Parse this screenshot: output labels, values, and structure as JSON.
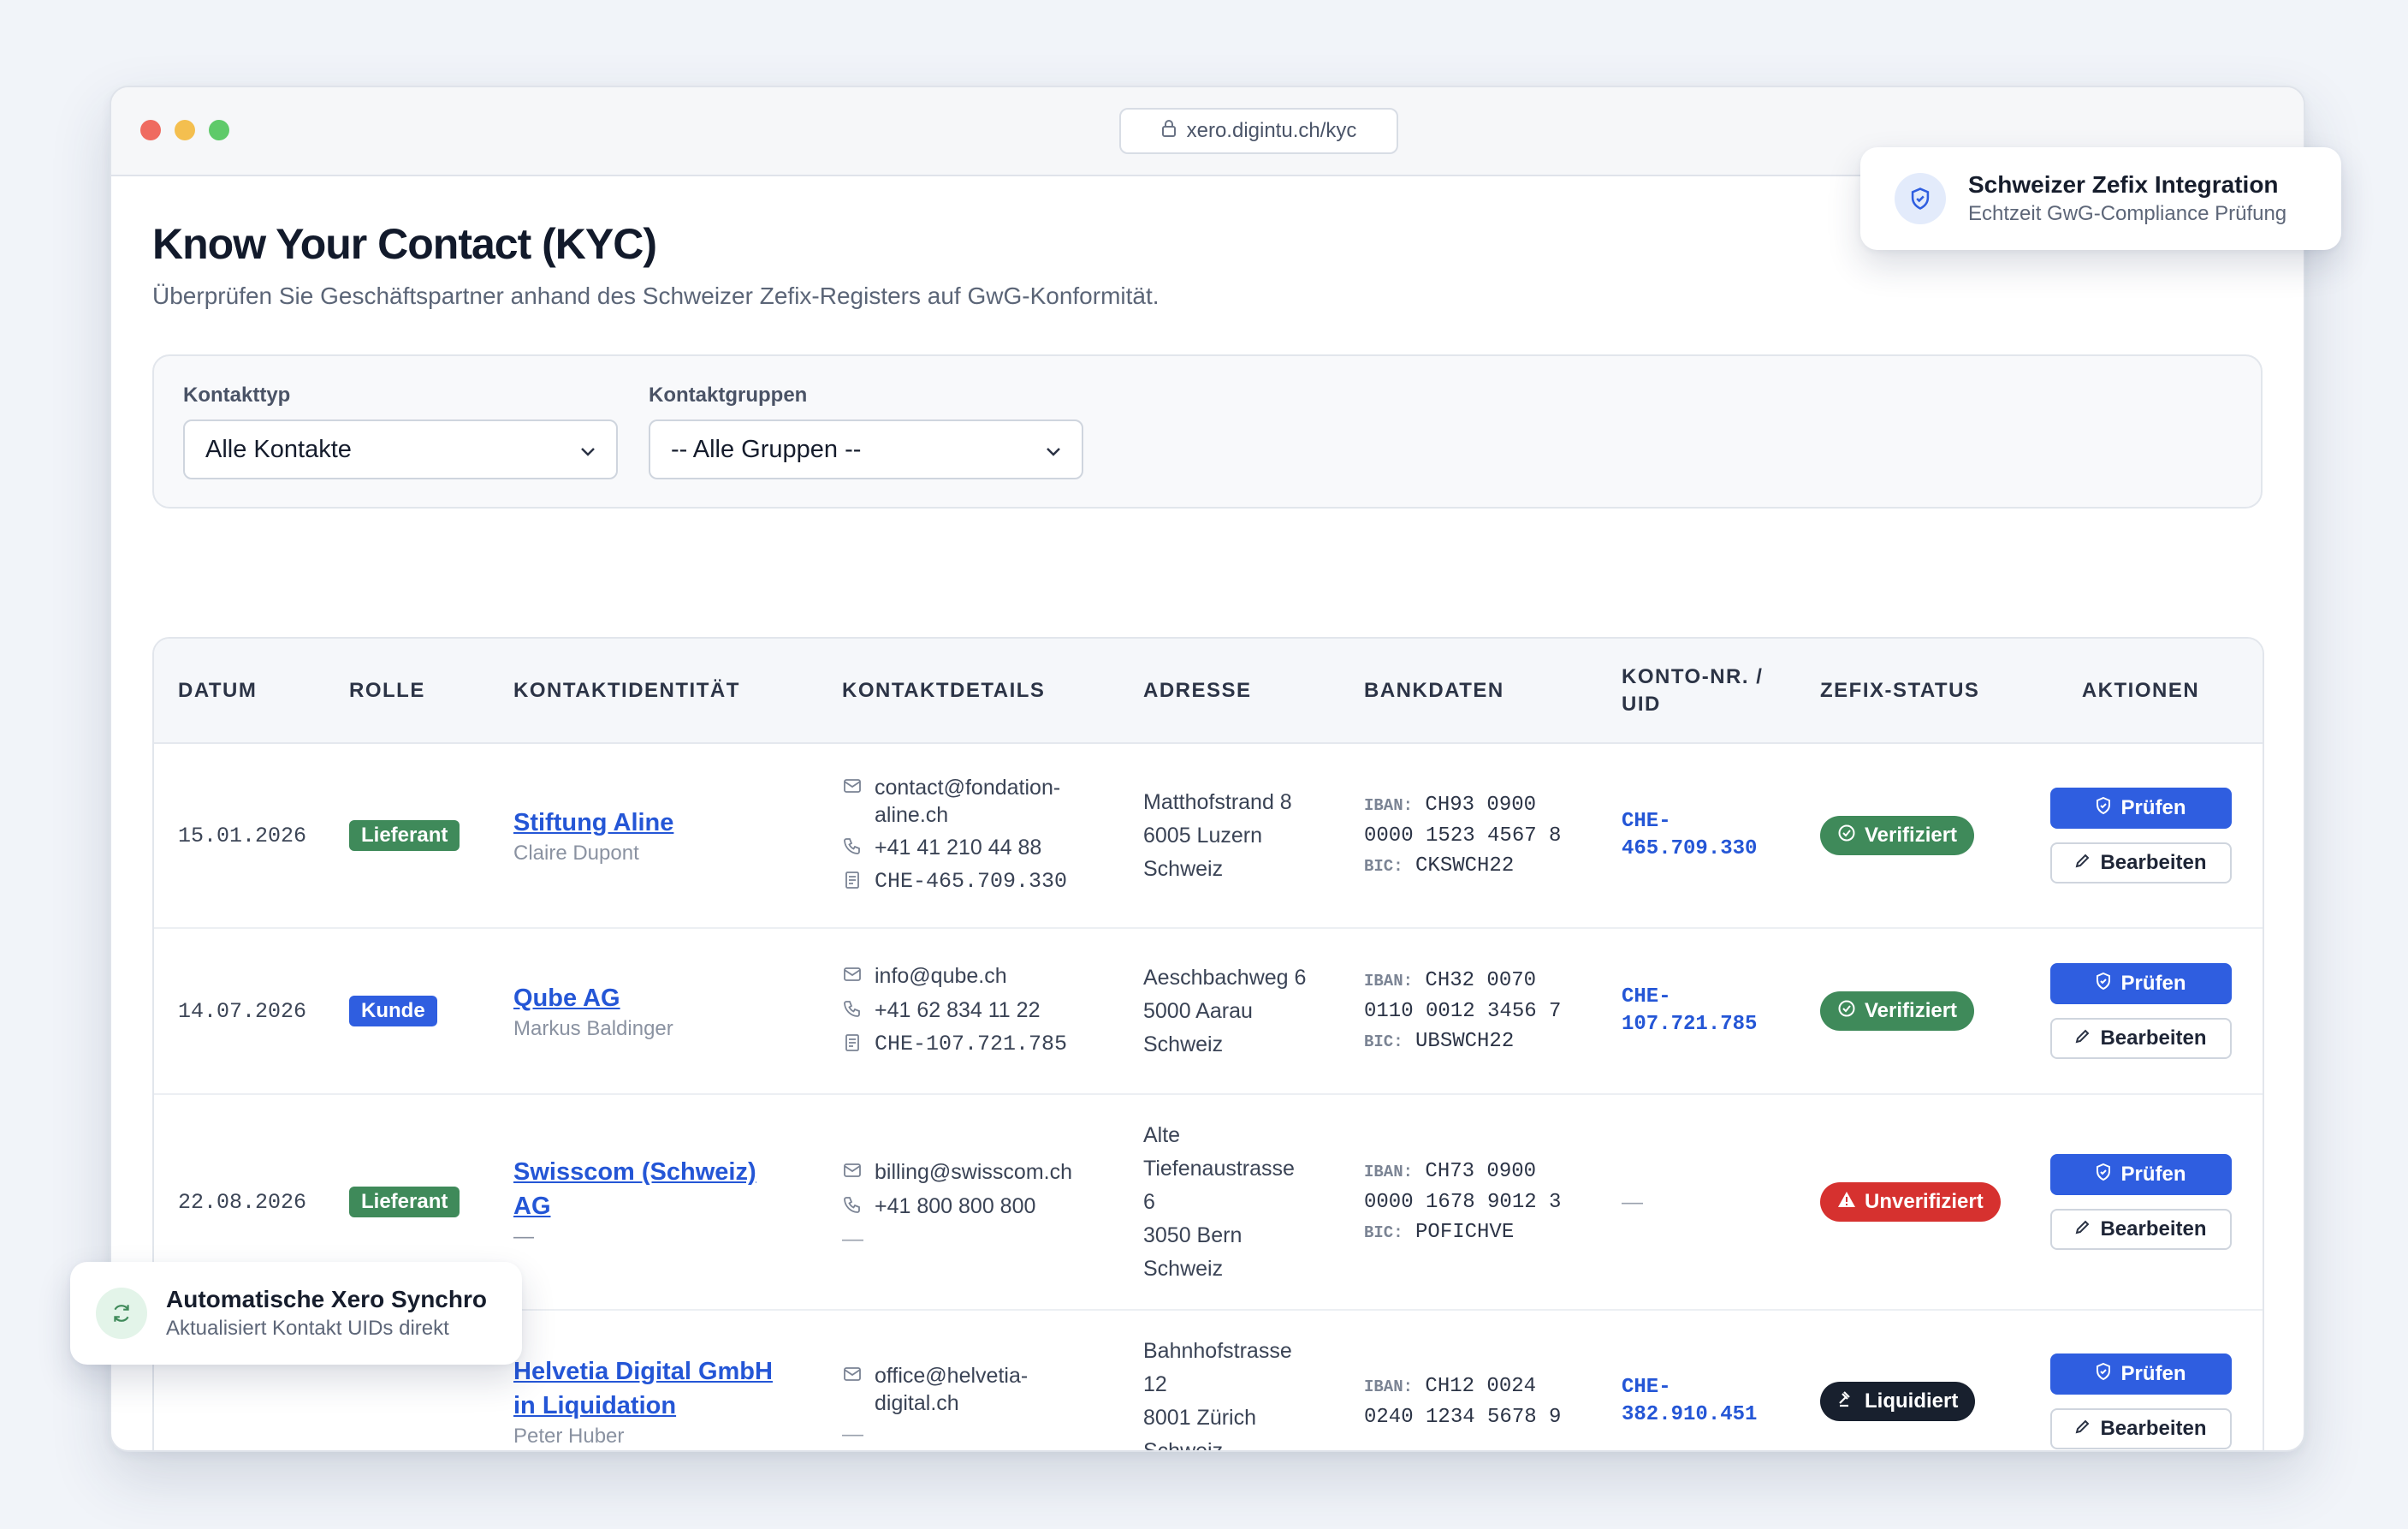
{
  "browser": {
    "url": "xero.digintu.ch/kyc"
  },
  "page": {
    "title": "Know Your Contact (KYC)",
    "subtitle": "Überprüfen Sie Geschäftspartner anhand des Schweizer Zefix-Registers auf GwG-Konformität."
  },
  "filters": {
    "type_label": "Kontakttyp",
    "type_value": "Alle Kontakte",
    "group_label": "Kontaktgruppen",
    "group_value": "-- Alle Gruppen --"
  },
  "table": {
    "headers": {
      "datum": "DATUM",
      "rolle": "ROLLE",
      "identitaet": "KONTAKTIDENTITÄT",
      "details": "KONTAKTDETAILS",
      "adresse": "ADRESSE",
      "bankdaten": "BANKDATEN",
      "konto_1": "KONTO-NR. /",
      "konto_2": "UID",
      "status": "ZEFIX-STATUS",
      "aktionen": "AKTIONEN"
    },
    "labels": {
      "iban": "IBAN:",
      "bic": "BIC:",
      "pruefen": "Prüfen",
      "bearbeiten": "Bearbeiten",
      "dash": "—"
    },
    "rows": [
      {
        "date": "15.01.2026",
        "role": "Lieferant",
        "name_1": "Stiftung Aline",
        "name_2": "",
        "person": "Claire Dupont",
        "email_1": "contact@fondation-",
        "email_2": "aline.ch",
        "phone": "+41 41 210 44 88",
        "uid_detail": "CHE-465.709.330",
        "addr_1": "Matthofstrand 8",
        "addr_2": "6005 Luzern",
        "addr_3": "Schweiz",
        "iban_1": "CH93 0900",
        "iban_2": "0000 1523 4567 8",
        "bic": "CKSWCH22",
        "uid_1": "CHE-",
        "uid_2": "465.709.330",
        "status": "Verifiziert"
      },
      {
        "date": "14.07.2026",
        "role": "Kunde",
        "name_1": "Qube AG",
        "person": "Markus Baldinger",
        "email_1": "info@qube.ch",
        "phone": "+41 62 834 11 22",
        "uid_detail": "CHE-107.721.785",
        "addr_1": "Aeschbachweg 6",
        "addr_2": "5000 Aarau",
        "addr_3": "Schweiz",
        "iban_1": "CH32 0070",
        "iban_2": "0110 0012 3456 7",
        "bic": "UBSWCH22",
        "uid_1": "CHE-",
        "uid_2": "107.721.785",
        "status": "Verifiziert"
      },
      {
        "date": "22.08.2026",
        "role": "Lieferant",
        "name_1": "Swisscom (Schweiz)",
        "name_2": "AG",
        "person": "—",
        "email_1": "billing@swisscom.ch",
        "phone": "+41 800 800 800",
        "addr_1": "Alte",
        "addr_2": "Tiefenaustrasse",
        "addr_3": "6",
        "addr_4": "3050 Bern",
        "addr_5": "Schweiz",
        "iban_1": "CH73 0900",
        "iban_2": "0000 1678 9012 3",
        "bic": "POFICHVE",
        "status": "Unverifiziert"
      },
      {
        "name_1": "Helvetia Digital GmbH",
        "name_2": "in Liquidation",
        "person": "Peter Huber",
        "email_1": "office@helvetia-",
        "email_2": "digital.ch",
        "addr_1": "Bahnhofstrasse",
        "addr_2": "12",
        "addr_3": "8001 Zürich",
        "addr_4": "Schweiz",
        "iban_1": "CH12 0024",
        "iban_2": "0240 1234 5678 9",
        "uid_1": "CHE-",
        "uid_2": "382.910.451",
        "status": "Liquidiert"
      }
    ]
  },
  "toasts": {
    "zefix_title": "Schweizer Zefix Integration",
    "zefix_sub": "Echtzeit GwG-Compliance Prüfung",
    "sync_title": "Automatische Xero Synchro",
    "sync_sub": "Aktualisiert Kontakt UIDs direkt"
  },
  "colors": {
    "accent": "#2f5ee0",
    "success": "#3f8a5a",
    "danger": "#d6312f",
    "dark": "#18202e"
  },
  "icons": [
    "lock-icon",
    "chevron-down-icon",
    "mail-icon",
    "phone-icon",
    "document-icon",
    "check-circle-icon",
    "warning-icon",
    "gavel-icon",
    "shield-icon",
    "pencil-icon",
    "sync-icon"
  ]
}
